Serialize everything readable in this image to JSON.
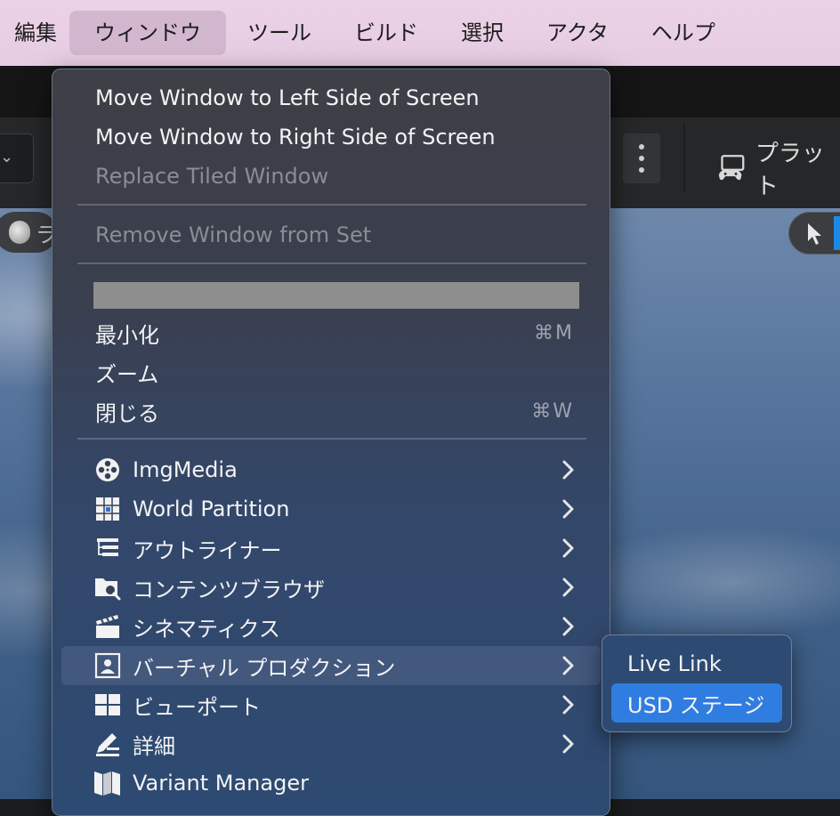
{
  "menubar": {
    "items": [
      {
        "label": "編集"
      },
      {
        "label": "ウィンドウ"
      },
      {
        "label": "ツール"
      },
      {
        "label": "ビルド"
      },
      {
        "label": "選択"
      },
      {
        "label": "アクタ"
      },
      {
        "label": "ヘルプ"
      }
    ]
  },
  "toolbar": {
    "platform_label": "プラット"
  },
  "viewport": {
    "left_pill_label": "ラ"
  },
  "window_menu": {
    "top_items": [
      {
        "label": "Move Window to Left Side of Screen",
        "enabled": true
      },
      {
        "label": "Move Window to Right Side of Screen",
        "enabled": true
      },
      {
        "label": "Replace Tiled Window",
        "enabled": false
      },
      {
        "label": "Remove Window from Set",
        "enabled": false
      }
    ],
    "window_items": [
      {
        "label": "最小化",
        "shortcut": "⌘M"
      },
      {
        "label": "ズーム",
        "shortcut": ""
      },
      {
        "label": "閉じる",
        "shortcut": "⌘W"
      }
    ],
    "app_items": [
      {
        "label": "ImgMedia",
        "icon": "film-reel-icon",
        "submenu": true
      },
      {
        "label": "World Partition",
        "icon": "world-partition-icon",
        "submenu": true
      },
      {
        "label": "アウトライナー",
        "icon": "outliner-icon",
        "submenu": true
      },
      {
        "label": "コンテンツブラウザ",
        "icon": "content-browser-icon",
        "submenu": true
      },
      {
        "label": "シネマティクス",
        "icon": "clapperboard-icon",
        "submenu": true
      },
      {
        "label": "バーチャル プロダクション",
        "icon": "virtual-production-icon",
        "submenu": true,
        "highlighted": true
      },
      {
        "label": "ビューポート",
        "icon": "viewport-grid-icon",
        "submenu": true
      },
      {
        "label": "詳細",
        "icon": "details-icon",
        "submenu": true
      },
      {
        "label": "Variant Manager",
        "icon": "variant-manager-icon",
        "submenu": false
      }
    ]
  },
  "submenu": {
    "items": [
      {
        "label": "Live Link",
        "selected": false
      },
      {
        "label": "USD ステージ",
        "selected": true
      }
    ]
  }
}
